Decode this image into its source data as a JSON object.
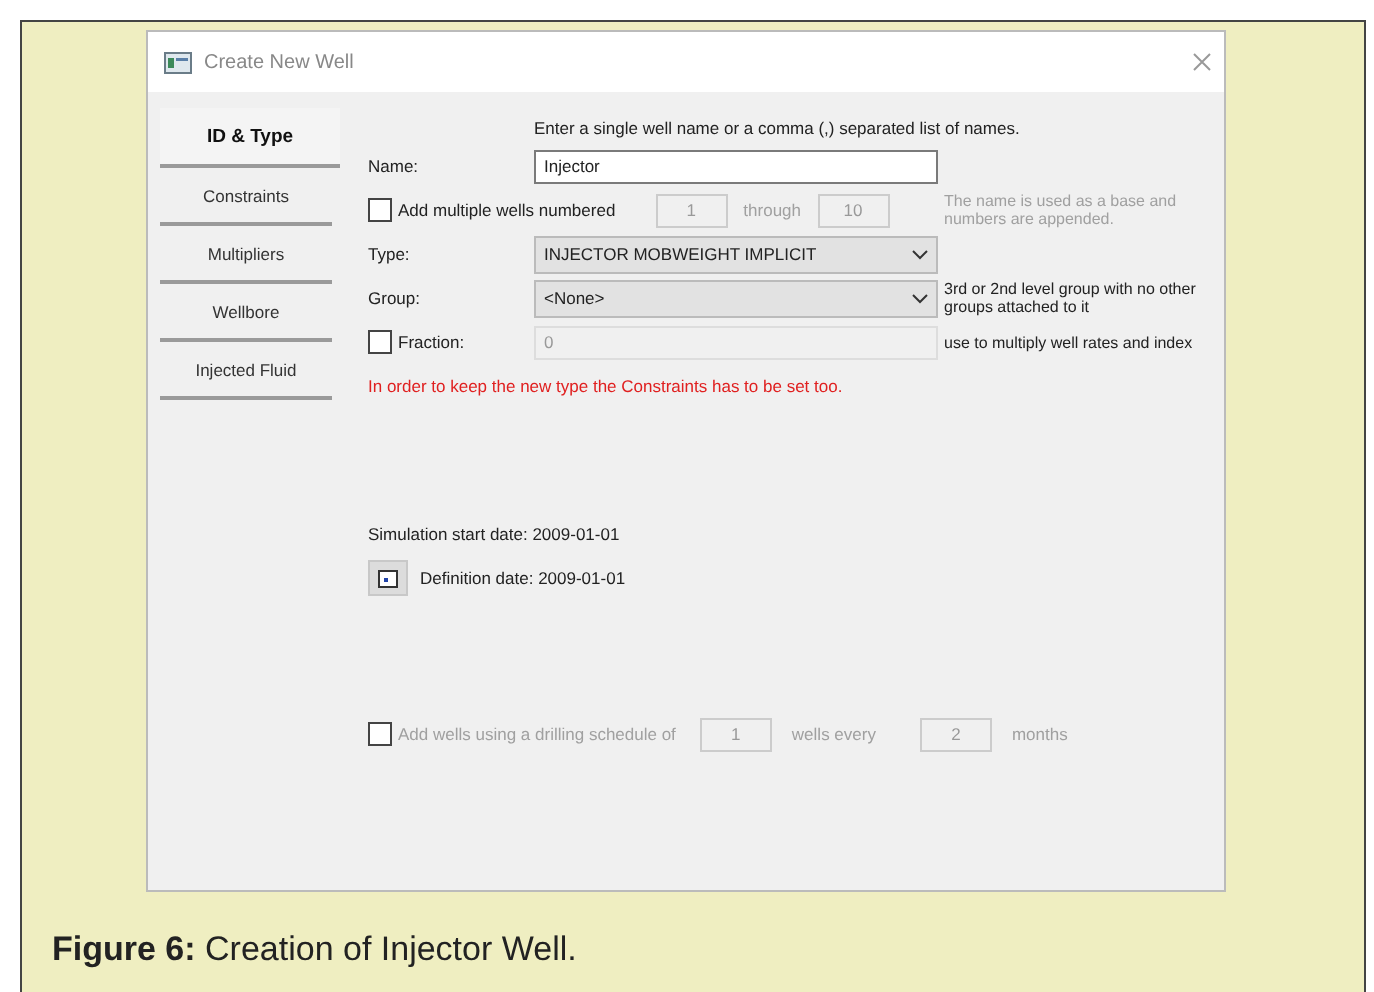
{
  "window": {
    "title": "Create New Well"
  },
  "tabs": [
    {
      "label": "ID & Type",
      "selected": true
    },
    {
      "label": "Constraints",
      "selected": false
    },
    {
      "label": "Multipliers",
      "selected": false
    },
    {
      "label": "Wellbore",
      "selected": false
    },
    {
      "label": "Injected Fluid",
      "selected": false
    }
  ],
  "form": {
    "hint": "Enter a single well name or a comma (,) separated list of names.",
    "name": {
      "label": "Name:",
      "value": "Injector"
    },
    "multiple": {
      "label": "Add multiple wells numbered",
      "checked": false,
      "disabled": true,
      "from": "1",
      "through": "through",
      "to": "10",
      "note": "The name is used as a base and numbers are appended."
    },
    "type": {
      "label": "Type:",
      "value": "INJECTOR MOBWEIGHT IMPLICIT"
    },
    "group": {
      "label": "Group:",
      "value": "<None>",
      "note": "3rd or 2nd level group with no other groups attached to it"
    },
    "fraction": {
      "label": "Fraction:",
      "checked": false,
      "value": "0",
      "note": "use to multiply well rates and index"
    },
    "warning": "In order to keep the new type the Constraints has to be set too.",
    "simulation_start": "Simulation start date: 2009-01-01",
    "definition_date": "Definition date: 2009-01-01",
    "schedule": {
      "label": "Add wells using a drilling schedule of",
      "checked": false,
      "disabled": true,
      "wells": "1",
      "middle": "wells every",
      "months": "2",
      "unit": "months"
    }
  },
  "caption": "**Figure 6:** Creation of Injector Well."
}
